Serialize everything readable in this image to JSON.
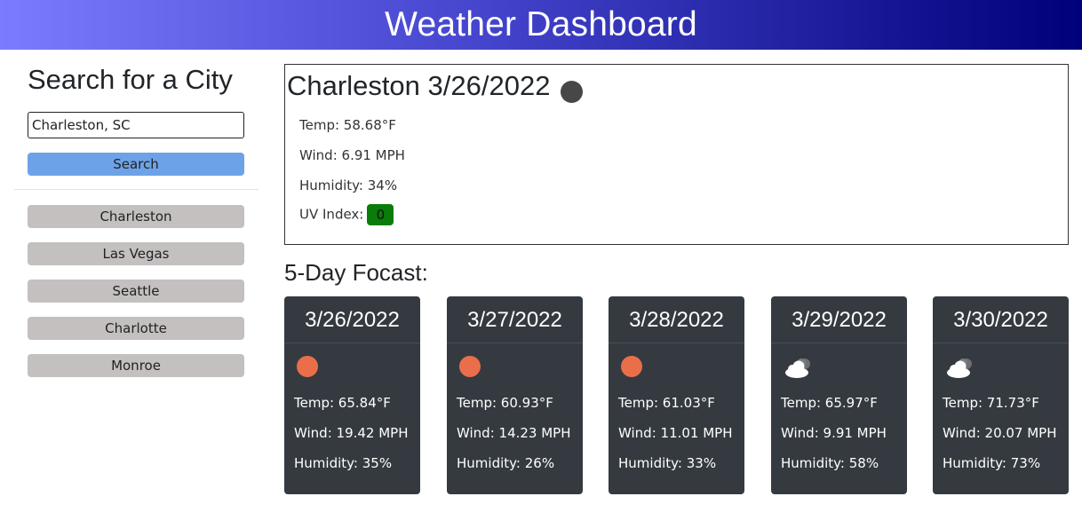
{
  "header": {
    "title": "Weather Dashboard"
  },
  "sidebar": {
    "heading": "Search for a City",
    "search_value": "Charleston, SC",
    "search_label": "Search",
    "history": [
      "Charleston",
      "Las Vegas",
      "Seattle",
      "Charlotte",
      "Monroe"
    ]
  },
  "current": {
    "title": "Charleston 3/26/2022",
    "icon": "weather-icon",
    "temp": "Temp: 58.68°F",
    "wind": "Wind: 6.91 MPH",
    "humidity": "Humidity: 34%",
    "uv_label": "UV Index:",
    "uv_value": "0",
    "uv_color": "#0a7c0a"
  },
  "forecast": {
    "title": "5-Day Focast:",
    "days": [
      {
        "date": "3/26/2022",
        "icon": "sun-icon",
        "temp": "Temp: 65.84°F",
        "wind": "Wind: 19.42 MPH",
        "humidity": "Humidity: 35%"
      },
      {
        "date": "3/27/2022",
        "icon": "sun-icon",
        "temp": "Temp: 60.93°F",
        "wind": "Wind: 14.23 MPH",
        "humidity": "Humidity: 26%"
      },
      {
        "date": "3/28/2022",
        "icon": "sun-icon",
        "temp": "Temp: 61.03°F",
        "wind": "Wind: 11.01 MPH",
        "humidity": "Humidity: 33%"
      },
      {
        "date": "3/29/2022",
        "icon": "cloud-icon",
        "temp": "Temp: 65.97°F",
        "wind": "Wind: 9.91 MPH",
        "humidity": "Humidity: 58%"
      },
      {
        "date": "3/30/2022",
        "icon": "cloud-icon",
        "temp": "Temp: 71.73°F",
        "wind": "Wind: 20.07 MPH",
        "humidity": "Humidity: 73%"
      }
    ]
  },
  "colors": {
    "header_start": "#7b7bff",
    "header_end": "#00007a",
    "search_button": "#6ea2e8",
    "history_button": "#c4c0c0",
    "card_bg": "#343a40",
    "sun": "#eb6e4b"
  }
}
